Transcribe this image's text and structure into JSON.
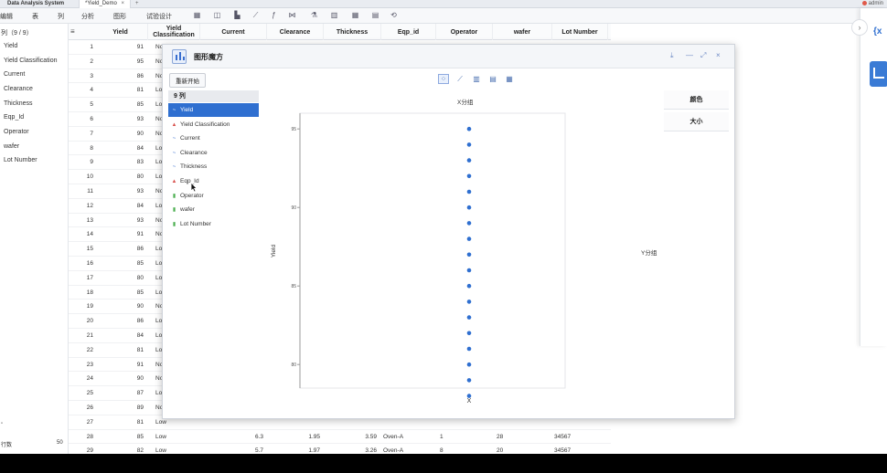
{
  "titlebar": {
    "app_title": "Data Analysis System",
    "doc_tab": "*Yield_Demo",
    "doc_tab_close": "×",
    "add_tab": "+",
    "user": "admin"
  },
  "menubar": {
    "items": [
      "编辑",
      "表",
      "列",
      "分析",
      "图形",
      "试验设计"
    ]
  },
  "left_panel": {
    "header": "列（9 / 9）",
    "columns": [
      "Yield",
      "Yield Classification",
      "Current",
      "Clearance",
      "Thickness",
      "Eqp_Id",
      "Operator",
      "wafer",
      "Lot Number"
    ],
    "rows_label": "行数",
    "rows_value": "50",
    "small_mark": "\""
  },
  "grid": {
    "corner_icon": "≡",
    "headers": [
      "Yield",
      "Yield\nClassification",
      "Current",
      "Clearance",
      "Thickness",
      "Eqp_id",
      "Operator",
      "wafer",
      "Lot Number"
    ],
    "rows": [
      {
        "n": "1",
        "yield": "91",
        "cls": "No"
      },
      {
        "n": "2",
        "yield": "95",
        "cls": "No"
      },
      {
        "n": "3",
        "yield": "86",
        "cls": "No"
      },
      {
        "n": "4",
        "yield": "81",
        "cls": "Low"
      },
      {
        "n": "5",
        "yield": "85",
        "cls": "Low"
      },
      {
        "n": "6",
        "yield": "93",
        "cls": "No"
      },
      {
        "n": "7",
        "yield": "90",
        "cls": "No"
      },
      {
        "n": "8",
        "yield": "84",
        "cls": "Low"
      },
      {
        "n": "9",
        "yield": "83",
        "cls": "Low"
      },
      {
        "n": "10",
        "yield": "80",
        "cls": "Low"
      },
      {
        "n": "11",
        "yield": "93",
        "cls": "No"
      },
      {
        "n": "12",
        "yield": "84",
        "cls": "Low"
      },
      {
        "n": "13",
        "yield": "93",
        "cls": "No"
      },
      {
        "n": "14",
        "yield": "91",
        "cls": "No"
      },
      {
        "n": "15",
        "yield": "86",
        "cls": "Low"
      },
      {
        "n": "16",
        "yield": "85",
        "cls": "Low"
      },
      {
        "n": "17",
        "yield": "80",
        "cls": "Low"
      },
      {
        "n": "18",
        "yield": "85",
        "cls": "Low"
      },
      {
        "n": "19",
        "yield": "90",
        "cls": "No"
      },
      {
        "n": "20",
        "yield": "86",
        "cls": "Low"
      },
      {
        "n": "21",
        "yield": "84",
        "cls": "Low"
      },
      {
        "n": "22",
        "yield": "81",
        "cls": "Low"
      },
      {
        "n": "23",
        "yield": "91",
        "cls": "No"
      },
      {
        "n": "24",
        "yield": "90",
        "cls": "No"
      },
      {
        "n": "25",
        "yield": "87",
        "cls": "Low"
      },
      {
        "n": "26",
        "yield": "89",
        "cls": "No"
      },
      {
        "n": "27",
        "yield": "81",
        "cls": "Low"
      },
      {
        "n": "28",
        "yield": "85",
        "cls": "Low",
        "current": "6.3",
        "clearance": "1.95",
        "thickness": "3.59",
        "eqp": "Oven-A",
        "operator": "1",
        "wafer": "28",
        "lot": "34567"
      },
      {
        "n": "29",
        "yield": "82",
        "cls": "Low",
        "current": "5.7",
        "clearance": "1.97",
        "thickness": "3.26",
        "eqp": "Oven-A",
        "operator": "8",
        "wafer": "20",
        "lot": "34567"
      }
    ]
  },
  "dialog": {
    "title": "图形魔方",
    "restart_label": "重新开始",
    "var_header": "9 列",
    "variables": [
      {
        "label": "Yield",
        "mark": "~",
        "mark_color": "#ffffff",
        "selected": true
      },
      {
        "label": "Yield Classification",
        "mark": "▲",
        "mark_color": "#d9534f",
        "selected": false
      },
      {
        "label": "Current",
        "mark": "~",
        "mark_color": "#3a6fd0",
        "selected": false
      },
      {
        "label": "Clearance",
        "mark": "~",
        "mark_color": "#3a6fd0",
        "selected": false
      },
      {
        "label": "Thickness",
        "mark": "~",
        "mark_color": "#3a6fd0",
        "selected": false
      },
      {
        "label": "Eqp_Id",
        "mark": "▲",
        "mark_color": "#d9534f",
        "selected": false
      },
      {
        "label": "Operator",
        "mark": "▮",
        "mark_color": "#4caf50",
        "selected": false
      },
      {
        "label": "wafer",
        "mark": "▮",
        "mark_color": "#4caf50",
        "selected": false
      },
      {
        "label": "Lot Number",
        "mark": "▮",
        "mark_color": "#4caf50",
        "selected": false
      }
    ],
    "window_controls": [
      "⤓",
      "—",
      "⤢",
      "×"
    ],
    "x_group_label": "X分组",
    "y_group_label": "Y分组",
    "color_label": "颜色",
    "size_label": "大小",
    "graph_tools": [
      "⁘",
      "⟋",
      "▥",
      "▤",
      "▦"
    ]
  },
  "right_panel": {
    "collapse_icon": "›",
    "fx_label": "{x"
  },
  "chart_data": {
    "type": "scatter",
    "title": "",
    "xlabel": "X",
    "ylabel": "Yield",
    "y_tick_labels": [
      "80",
      "85",
      "90",
      "95"
    ],
    "ylim": [
      78.5,
      96
    ],
    "x": [
      0,
      0,
      0,
      0,
      0,
      0,
      0,
      0,
      0,
      0,
      0,
      0,
      0,
      0,
      0,
      0,
      0,
      0
    ],
    "y": [
      95,
      94,
      93,
      92,
      91,
      90,
      89,
      88,
      87,
      86,
      85,
      84,
      83,
      82,
      81,
      80,
      79,
      78
    ],
    "point_color": "#2f6fd0",
    "grid": false
  }
}
